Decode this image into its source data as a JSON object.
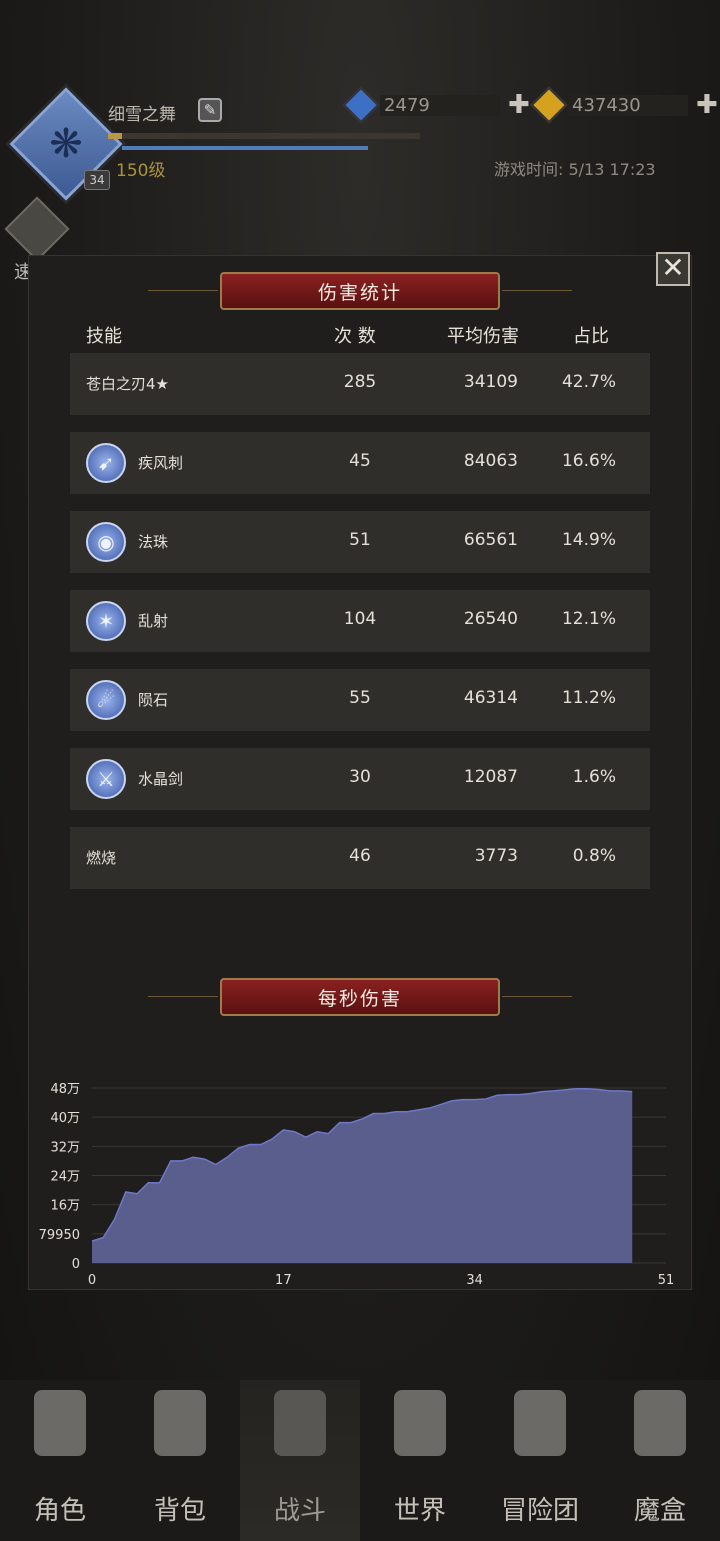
{
  "header": {
    "player_name": "细雪之舞",
    "avatar_level": "34",
    "level": "150级",
    "currency": [
      {
        "name": "blue-gem",
        "amount": "2479",
        "color": "#3d6fc4"
      },
      {
        "name": "gold-gem",
        "amount": "437430",
        "color": "#d4a21e"
      }
    ],
    "game_time": "游戏时间: 5/13 17:23",
    "speed_label": "速战",
    "plus": "✚"
  },
  "panel": {
    "title": "伤害统计",
    "close": "✕",
    "columns": [
      "技能",
      "次 数",
      "平均伤害",
      "占比"
    ],
    "rows": [
      {
        "name": "苍白之刃4★",
        "icon": "",
        "count": "285",
        "avg": "34109",
        "pct": "42.7%"
      },
      {
        "name": "疾风刺",
        "icon": "gale-stab-icon",
        "glyph": "➹",
        "count": "45",
        "avg": "84063",
        "pct": "16.6%"
      },
      {
        "name": "法珠",
        "icon": "orb-icon",
        "glyph": "◉",
        "count": "51",
        "avg": "66561",
        "pct": "14.9%"
      },
      {
        "name": "乱射",
        "icon": "barrage-icon",
        "glyph": "✶",
        "count": "104",
        "avg": "26540",
        "pct": "12.1%"
      },
      {
        "name": "陨石",
        "icon": "meteor-icon",
        "glyph": "☄",
        "count": "55",
        "avg": "46314",
        "pct": "11.2%"
      },
      {
        "name": "水晶剑",
        "icon": "crystal-sword-icon",
        "glyph": "⚔",
        "count": "30",
        "avg": "12087",
        "pct": "1.6%"
      },
      {
        "name": "燃烧",
        "icon": "",
        "count": "46",
        "avg": "3773",
        "pct": "0.8%"
      }
    ],
    "dps_title": "每秒伤害"
  },
  "chart_data": {
    "type": "area",
    "ylabels": [
      "48万",
      "40万",
      "32万",
      "24万",
      "16万",
      "79950",
      "0"
    ],
    "yticks": [
      480000,
      400000,
      320000,
      240000,
      160000,
      79950,
      0
    ],
    "xticks": [
      0,
      17,
      34,
      51
    ],
    "xlim": [
      0,
      51
    ],
    "ylim": [
      0,
      480000
    ],
    "x": [
      0,
      1,
      2,
      3,
      4,
      5,
      6,
      7,
      8,
      9,
      10,
      11,
      12,
      13,
      14,
      15,
      16,
      17,
      18,
      19,
      20,
      21,
      22,
      23,
      24,
      25,
      26,
      27,
      28,
      29,
      30,
      31,
      32,
      33,
      34,
      35,
      36,
      37,
      38,
      39,
      40,
      41,
      42,
      43,
      44,
      45,
      46,
      47,
      48
    ],
    "values": [
      60000,
      70000,
      120000,
      195000,
      190000,
      220000,
      220000,
      280000,
      280000,
      290000,
      285000,
      270000,
      290000,
      315000,
      325000,
      325000,
      340000,
      365000,
      360000,
      345000,
      360000,
      355000,
      385000,
      385000,
      395000,
      410000,
      410000,
      415000,
      415000,
      420000,
      425000,
      435000,
      445000,
      448000,
      448000,
      450000,
      460000,
      462000,
      462000,
      465000,
      470000,
      472000,
      475000,
      478000,
      478000,
      476000,
      472000,
      472000,
      470000
    ],
    "fill": "#5a5e8c",
    "stroke": "#6f78c8",
    "grid": true
  },
  "nav": [
    {
      "label": "角色",
      "icon": "helmet-icon"
    },
    {
      "label": "背包",
      "icon": "backpack-icon"
    },
    {
      "label": "战斗",
      "icon": "swords-shield-icon",
      "active": true
    },
    {
      "label": "世界",
      "icon": "map-scroll-icon"
    },
    {
      "label": "冒险团",
      "icon": "castle-icon"
    },
    {
      "label": "魔盒",
      "icon": "cube-icon"
    }
  ]
}
